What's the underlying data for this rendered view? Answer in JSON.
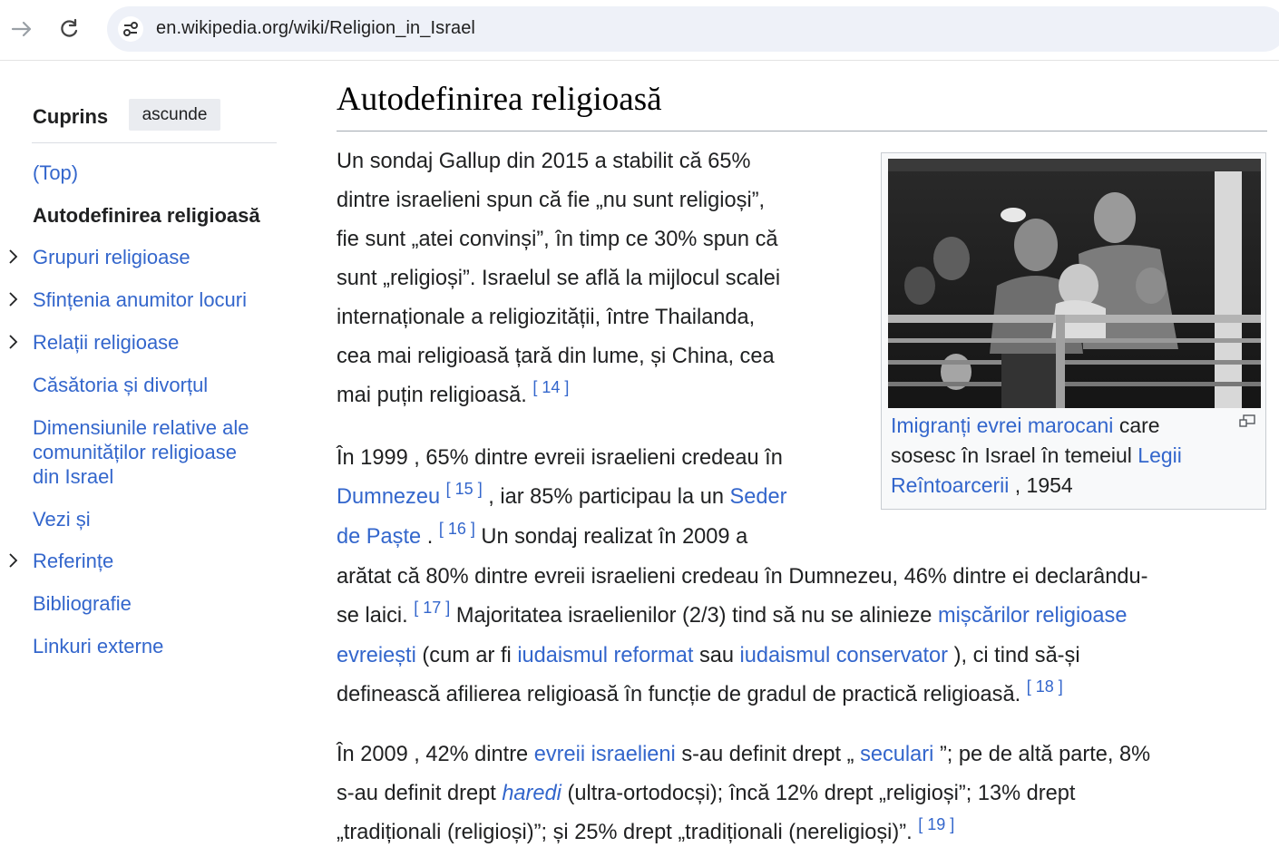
{
  "browser": {
    "url": "en.wikipedia.org/wiki/Religion_in_Israel"
  },
  "toc": {
    "title": "Cuprins",
    "hide_label": "ascunde",
    "items": [
      {
        "label": "(Top)"
      },
      {
        "label": "Autodefinirea religioasă"
      },
      {
        "label": "Grupuri religioase"
      },
      {
        "label": "Sfințenia anumitor locuri"
      },
      {
        "label": "Relații religioase"
      },
      {
        "label": "Căsătoria și divorțul"
      },
      {
        "label": "Dimensiunile relative ale comunităților religioase din Israel"
      },
      {
        "label": "Vezi și"
      },
      {
        "label": "Referințe"
      },
      {
        "label": "Bibliografie"
      },
      {
        "label": "Linkuri externe"
      }
    ]
  },
  "article": {
    "heading": "Autodefinirea religioasă",
    "p1": {
      "lines": [
        "Un sondaj Gallup din 2015 a stabilit că 65%",
        "dintre israelieni spun că fie „nu sunt religioși”,",
        "fie sunt „atei convinși”, în timp ce 30% spun că",
        "sunt „religioși”. Israelul se află la mijlocul scalei",
        "internaționale a religiozității, între Thailanda,",
        "cea mai religioasă țară din lume, și China, cea",
        "mai puțin religioasă."
      ],
      "ref14": "[ 14 ]"
    },
    "p2": {
      "t1": "În 1999 , 65% dintre evreii israelieni credeau în",
      "l_dumnezeu": "Dumnezeu",
      "ref15": "[ 15 ]",
      "t2": ", iar 85% participau la un",
      "l_seder1": "Seder",
      "l_seder2": "de Paște",
      "t3": ".",
      "ref16": "[ 16 ]",
      "t4": "Un sondaj realizat în 2009 a",
      "t5": "arătat că 80% dintre evreii israelieni credeau în Dumnezeu, 46% dintre ei declarându-",
      "t6": "se laici.",
      "ref17": "[ 17 ]",
      "t7": "Majoritatea israelienilor (2/3) tind să nu se alinieze",
      "l_misc1": "mișcărilor religioase",
      "l_misc2": "evreiești",
      "t8": "(cum ar fi",
      "l_reform": "iudaismul reformat",
      "t9": "sau",
      "l_conserv": "iudaismul conservator",
      "t10": "), ci tind să-și",
      "t11": "definească afilierea religioasă în funcție de gradul de practică religioasă.",
      "ref18": "[ 18 ]"
    },
    "p3": {
      "t1": "În 2009 , 42% dintre",
      "l_evrei": "evreii israelieni",
      "t2": "s-au definit drept „",
      "l_seculari": "seculari",
      "t3": "”; pe de altă parte, 8%",
      "t4": "s-au definit drept",
      "l_haredi": "haredi",
      "t5": "(ultra-ortodocși); încă 12% drept „religioși”; 13% drept",
      "t6": "„tradiționali (religioși)”; și 25% drept „tradiționali (nereligioși)”.",
      "ref19": "[ 19 ]"
    },
    "figure": {
      "caption_link1": "Imigranți evrei marocani",
      "caption_t1": "care sosesc în Israel în temeiul",
      "caption_link2": "Legii Reîntoarcerii",
      "caption_t2": ", 1954"
    }
  }
}
